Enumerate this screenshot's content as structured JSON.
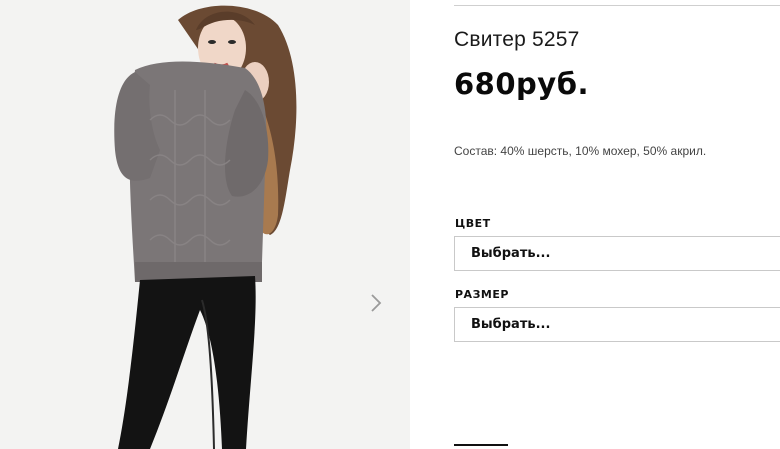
{
  "product": {
    "title": "Свитер 5257",
    "price": "680руб.",
    "composition": "Состав: 40% шерсть, 10% мохер, 50% акрил."
  },
  "options": {
    "color": {
      "label": "ЦВЕТ",
      "selected": "Выбрать..."
    },
    "size": {
      "label": "РАЗМЕР",
      "selected": "Выбрать..."
    }
  },
  "gallery": {
    "next_icon": "chevron-right-icon"
  }
}
